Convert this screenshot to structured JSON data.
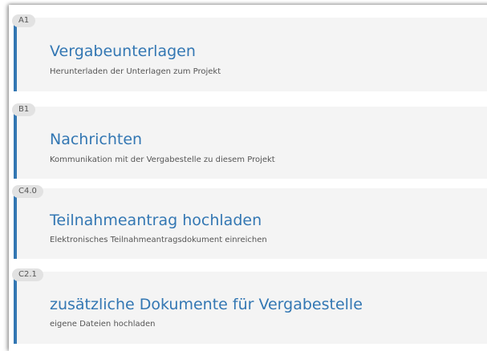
{
  "accent_color": "#3377b3",
  "items": [
    {
      "code": "A1",
      "title": "Vergabeunterlagen",
      "description": "Herunterladen der Unterlagen zum Projekt"
    },
    {
      "code": "B1",
      "title": "Nachrichten",
      "description": "Kommunikation mit der Vergabestelle zu diesem Projekt"
    },
    {
      "code": "C4.0",
      "title": "Teilnahmeantrag hochladen",
      "description": "Elektronisches Teilnahmeantragsdokument einreichen"
    },
    {
      "code": "C2.1",
      "title": "zusätzliche Dokumente für Vergabestelle",
      "description": "eigene Dateien hochladen"
    }
  ]
}
